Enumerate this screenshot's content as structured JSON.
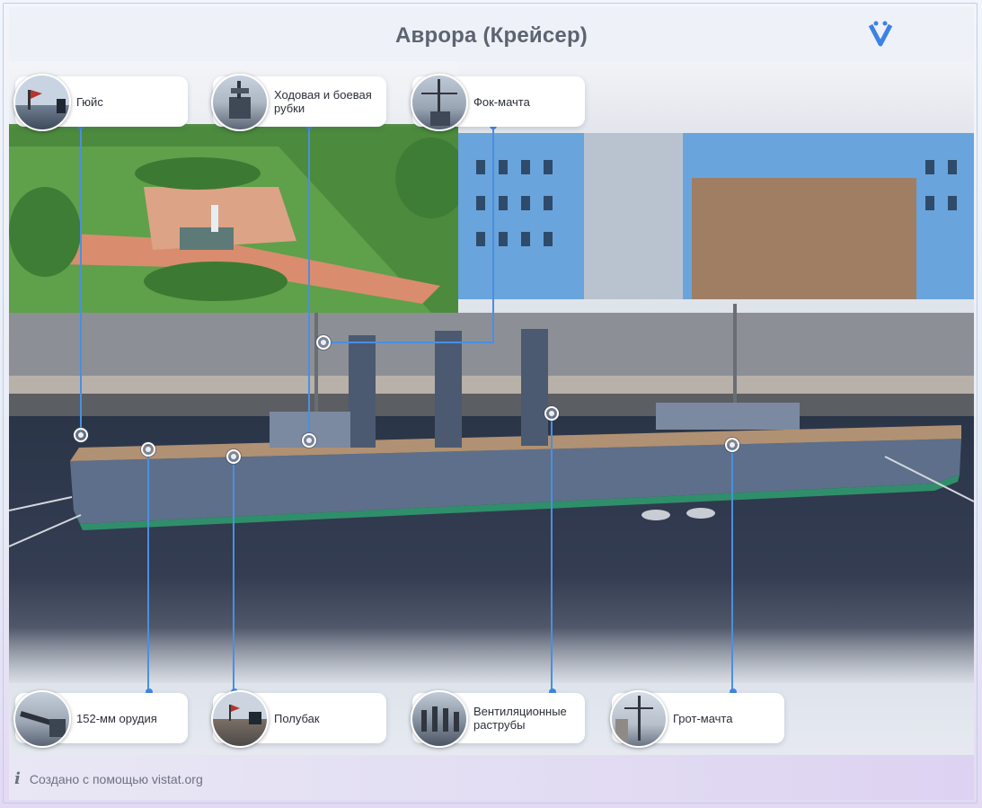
{
  "header": {
    "title": "Аврора (Крейсер)"
  },
  "labels_top": [
    {
      "id": "guys",
      "text": "Гюйс"
    },
    {
      "id": "rubki",
      "text": "Ходовая и боевая рубки"
    },
    {
      "id": "fok",
      "text": "Фок-мачта"
    }
  ],
  "labels_bottom": [
    {
      "id": "guns",
      "text": "152-мм орудия"
    },
    {
      "id": "polubak",
      "text": "Полубак"
    },
    {
      "id": "vent",
      "text": "Вентиляционные раструбы"
    },
    {
      "id": "grot",
      "text": "Грот-мачта"
    }
  ],
  "footer": {
    "text": "Создано с помощью vistat.org"
  },
  "colors": {
    "accent": "#3d86e0",
    "title": "#5d6371",
    "water": "#2f3a4b",
    "hull": "#5d6f8a"
  },
  "icons": [
    "vistat-logo-icon",
    "info-icon"
  ]
}
